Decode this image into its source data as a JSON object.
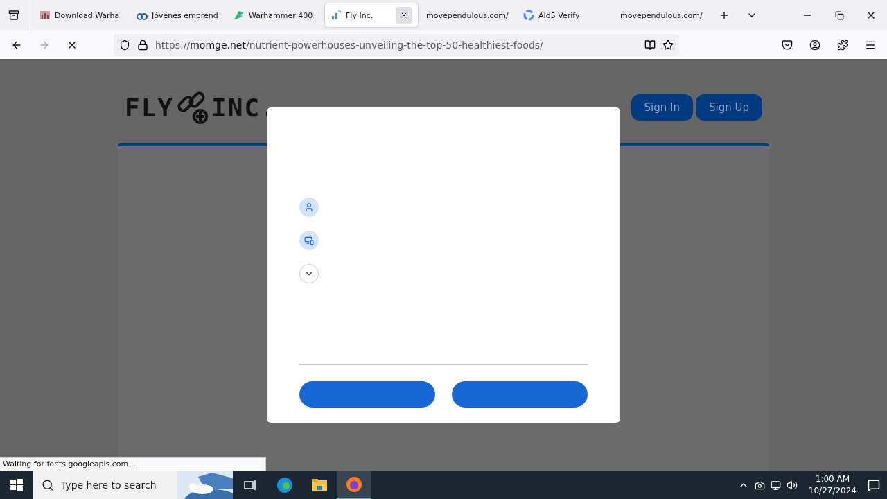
{
  "tabs": [
    {
      "title": "Download Warha",
      "selected": false
    },
    {
      "title": "Jóvenes emprend",
      "selected": false
    },
    {
      "title": "Warhammer 400",
      "selected": false
    },
    {
      "title": "Fly Inc.",
      "selected": true
    },
    {
      "title": "movependulous.com/",
      "selected": false
    },
    {
      "title": "AId5 Verify",
      "selected": false
    },
    {
      "title": "movependulous.com/",
      "selected": false
    }
  ],
  "address": {
    "scheme": "https://",
    "domain": "momge.net",
    "path": "/nutrient-powerhouses-unveiling-the-top-50-healthiest-foods/"
  },
  "site": {
    "logo_left": "FLY",
    "logo_right": "INC.",
    "buttons": [
      "Sign In",
      "Sign Up"
    ]
  },
  "dialog": {
    "rows": [
      {
        "kind": "person"
      },
      {
        "kind": "devices"
      },
      {
        "kind": "expand"
      }
    ],
    "buttons": [
      {
        "kind": "primary"
      },
      {
        "kind": "primary"
      }
    ]
  },
  "status_text": "Waiting for fonts.googleapis.com...",
  "taskbar": {
    "search_placeholder": "Type here to search",
    "time": "1:00 AM",
    "date": "10/27/2024"
  }
}
